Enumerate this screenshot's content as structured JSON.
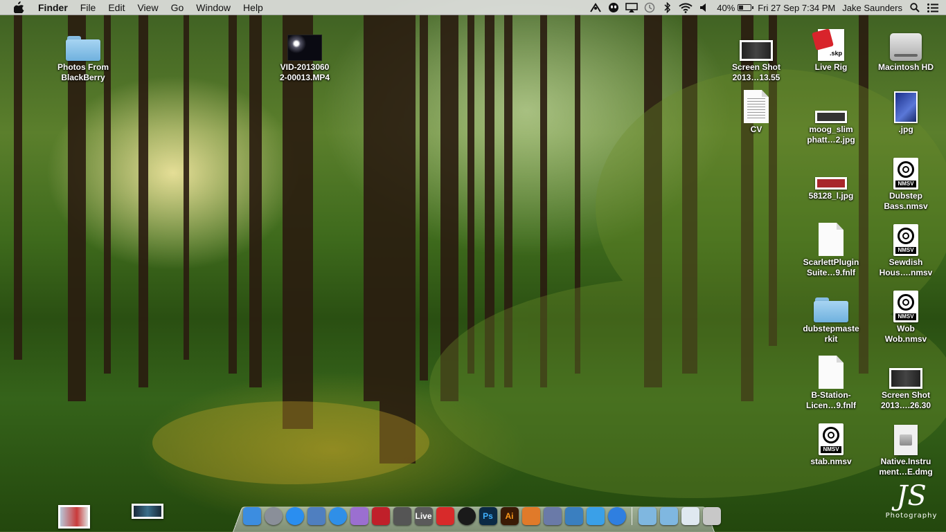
{
  "menubar": {
    "app_name": "Finder",
    "menus": [
      "File",
      "Edit",
      "View",
      "Go",
      "Window",
      "Help"
    ],
    "status_icons": [
      "bluetooth-share-icon",
      "alien-icon",
      "airplay-icon",
      "time-machine-icon",
      "bluetooth-icon",
      "wifi-icon",
      "volume-icon"
    ],
    "battery_percent": "40%",
    "battery_level": 0.4,
    "datetime": "Fri 27 Sep  7:34 PM",
    "user": "Jake Saunders"
  },
  "desktop": {
    "icons": [
      {
        "label": "Photos From\nBlackBerry",
        "kind": "folder"
      },
      {
        "label": "VID-2013060\n2-00013.MP4",
        "kind": "video"
      },
      {
        "label": "Screen Shot\n2013…13.55",
        "kind": "screenshot"
      },
      {
        "label": "Live Rig",
        "kind": "skp"
      },
      {
        "label": "Macintosh HD",
        "kind": "hard-drive"
      },
      {
        "label": "CV",
        "kind": "document"
      },
      {
        "label": "moog_slim\nphatt…2.jpg",
        "kind": "image"
      },
      {
        "label": ".jpg",
        "kind": "image"
      },
      {
        "label": "58128_l.jpg",
        "kind": "image"
      },
      {
        "label": "Dubstep\nBass.nmsv",
        "kind": "nmsv"
      },
      {
        "label": "ScarlettPlugin\nSuite…9.fnlf",
        "kind": "document"
      },
      {
        "label": "Sewdish\nHous….nmsv",
        "kind": "nmsv"
      },
      {
        "label": "dubstepmaste\nrkit",
        "kind": "folder"
      },
      {
        "label": "Wob\nWob.nmsv",
        "kind": "nmsv"
      },
      {
        "label": "B-Station-\nLicen…9.fnlf",
        "kind": "document"
      },
      {
        "label": "Screen Shot\n2013….26.30",
        "kind": "screenshot"
      },
      {
        "label": "stab.nmsv",
        "kind": "nmsv"
      },
      {
        "label": "Native.Instru\nment…E.dmg",
        "kind": "dmg"
      }
    ],
    "nmsv_badge": "NMSV",
    "skp_badge": ".skp"
  },
  "dock": {
    "items": [
      {
        "name": "finder-icon",
        "text": "",
        "color": "#3c8de0"
      },
      {
        "name": "launchpad-icon",
        "text": "",
        "color": "#8a8f99"
      },
      {
        "name": "app-store-icon",
        "text": "",
        "color": "#2a8ef0"
      },
      {
        "name": "mail-icon",
        "text": "",
        "color": "#4f7fc0"
      },
      {
        "name": "safari-icon",
        "text": "",
        "color": "#2f8fe8"
      },
      {
        "name": "chemistry-app-icon",
        "text": "",
        "color": "#9b6fd0"
      },
      {
        "name": "photo-booth-icon",
        "text": "",
        "color": "#c0202a"
      },
      {
        "name": "aperture-icon",
        "text": "",
        "color": "#555555"
      },
      {
        "name": "ableton-live-icon",
        "text": "Live",
        "color": "#5a5a5a"
      },
      {
        "name": "sketchup-icon",
        "text": "",
        "color": "#d82a2a"
      },
      {
        "name": "camera-icon",
        "text": "",
        "color": "#1a1a1a"
      },
      {
        "name": "photoshop-icon",
        "text": "Ps",
        "color": "#0b2a45"
      },
      {
        "name": "illustrator-icon",
        "text": "Ai",
        "color": "#3a1a05"
      },
      {
        "name": "presentation-icon",
        "text": "",
        "color": "#e07a2a"
      },
      {
        "name": "draw-tool-icon",
        "text": "",
        "color": "#6a7aa8"
      },
      {
        "name": "dashboard-icon",
        "text": "",
        "color": "#3a7fc0"
      },
      {
        "name": "twitter-icon",
        "text": "",
        "color": "#3aa0e8"
      },
      {
        "name": "itunes-icon",
        "text": "",
        "color": "#2f7fe0"
      }
    ],
    "right_items": [
      {
        "name": "downloads-folder-icon",
        "color": "#7fb7e0"
      },
      {
        "name": "applications-folder-icon",
        "color": "#7fb7e0"
      },
      {
        "name": "preview-stack-icon",
        "color": "#dfe8f0"
      },
      {
        "name": "trash-icon",
        "color": "#c8c8c8"
      }
    ]
  },
  "watermark": {
    "initials": "JS",
    "word": "Photography"
  }
}
